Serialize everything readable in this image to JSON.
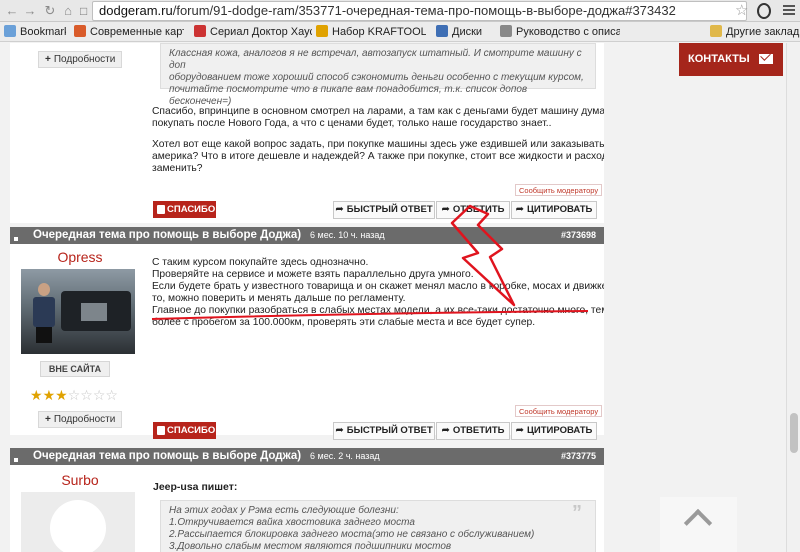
{
  "browser": {
    "url_host": "dodgeram.ru",
    "url_path": "/forum/91-dodge-ram/353771-очередная-тема-про-помощь-в-выборе-доджа#373432",
    "bookmarks": [
      {
        "label": "Bookmarks",
        "color": "#6aa0d8"
      },
      {
        "label": "Современные карты",
        "color": "#d95b2a"
      },
      {
        "label": "Сериал Доктор Хаус",
        "color": "#c33"
      },
      {
        "label": "Набор KRAFTOOL \"IN",
        "color": "#e0a200"
      },
      {
        "label": "Диски",
        "color": "#3f6fb5"
      },
      {
        "label": "Руководство с описа",
        "color": "#888"
      },
      {
        "label": "Другие закладки",
        "color": "#e0b84a"
      }
    ]
  },
  "post1": {
    "details_label": "Подробности",
    "quote_lines": [
      "Классная кожа, аналогов я не встречал, автозапуск штатный. И смотрите машину с доп",
      "оборудованием тоже хороший способ сэкономить деньги особенно с текущим курсом,",
      "почитайте посмотрите что в пикапе вам понадобится, т.к. список допов бесконечен=)"
    ],
    "para1": [
      "Спасибо, впринципе в основном смотрел на ларами, а там как с деньгами будет машину думаю",
      "покупать после Нового Года, а что с ценами будет, только наше государство знает.."
    ],
    "para2": [
      "Хотел вот еще какой вопрос задать, при покупке машины здесь уже ездившей или заказывать из",
      "америка? Что в итоге дешевле и надеждей? А также при покупке, стоит все жидкости и расходники",
      "заменить?"
    ],
    "report_label": "Сообщить модератору"
  },
  "actions": {
    "thanks_label": "СПАСИБО",
    "quick_reply_label": "БЫСТРЫЙ ОТВЕТ",
    "reply_label": "ОТВЕТИТЬ",
    "quote_label": "ЦИТИРОВАТЬ"
  },
  "post2": {
    "title": "Очередная тема про помощь в выборе Доджа)",
    "time": "6 мес. 10 ч. назад",
    "number": "#373698",
    "username": "Opress",
    "status_label": "ВНЕ САЙТА",
    "rating": 3,
    "rating_max": 7,
    "details_label": "Подробности",
    "lines": [
      "С таким курсом покупайте здесь однозначно.",
      "Проверяйте на сервисе и можете взять параллельно друга умного.",
      "Если будете брать у известного товарища и он скажет менял масло в коробке, мосах и движке тогда",
      "то, можно поверить и менять дальше по регламенту.",
      "Главное до покупки разобраться в слабых местах модели, а их все-таки достаточно много, тем",
      "более с пробегом за 100.000км, проверять эти слабые места и все будет супер."
    ],
    "report_label": "Сообщить модератору"
  },
  "post3": {
    "title": "Очередная тема про помощь в выборе Доджа)",
    "time": "6 мес. 2 ч. назад",
    "number": "#373775",
    "username": "Surbo",
    "quote_author": "Jeep-usa пишет:",
    "quote_lines": [
      "На этих годах у Рэма есть следующие болезни:",
      "1.Откручивается вайка хвостовика заднего моста",
      "2.Рассыпается блокировка заднего моста(это не связано с обслуживанием)",
      "3.Довольно слабым местом являются подшипники мостов"
    ]
  },
  "sidebar": {
    "contacts_label": "КОНТАКТЫ"
  },
  "colors": {
    "accent_red": "#b7241b",
    "header_gray": "#6b6b6b",
    "annotation_red": "#e0141e"
  }
}
